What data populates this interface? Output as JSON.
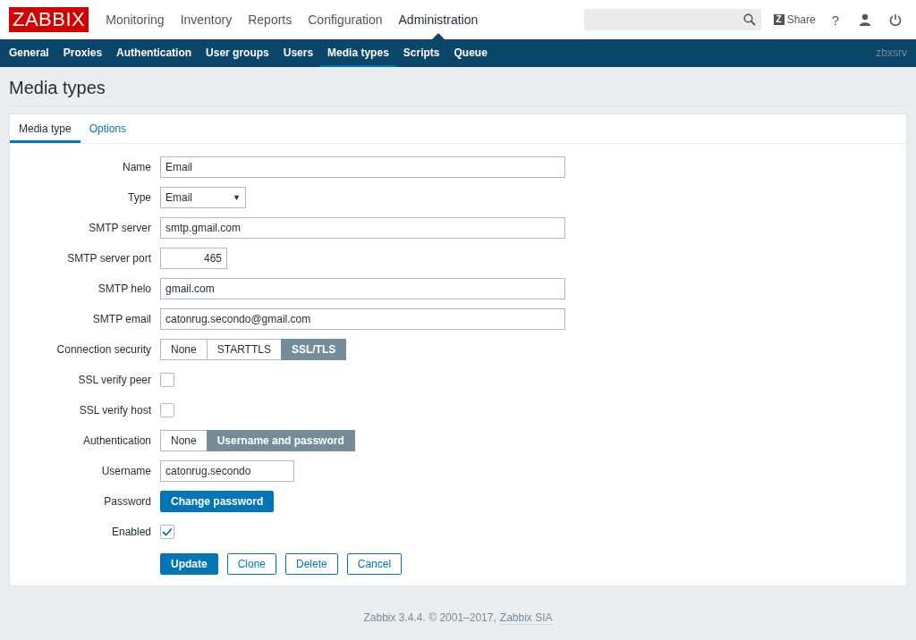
{
  "logo": "ZABBIX",
  "main_menu": [
    {
      "label": "Monitoring",
      "selected": false
    },
    {
      "label": "Inventory",
      "selected": false
    },
    {
      "label": "Reports",
      "selected": false
    },
    {
      "label": "Configuration",
      "selected": false
    },
    {
      "label": "Administration",
      "selected": true
    }
  ],
  "share": {
    "label": "Share",
    "icon_letter": "Z"
  },
  "help": "?",
  "sub_menu": [
    {
      "label": "General",
      "selected": false
    },
    {
      "label": "Proxies",
      "selected": false
    },
    {
      "label": "Authentication",
      "selected": false
    },
    {
      "label": "User groups",
      "selected": false
    },
    {
      "label": "Users",
      "selected": false
    },
    {
      "label": "Media types",
      "selected": true
    },
    {
      "label": "Scripts",
      "selected": false
    },
    {
      "label": "Queue",
      "selected": false
    }
  ],
  "server_name": "zbxsrv",
  "page_title": "Media types",
  "tabs": [
    {
      "label": "Media type",
      "selected": true
    },
    {
      "label": "Options",
      "selected": false
    }
  ],
  "form": [
    {
      "kind": "text",
      "label": "Name",
      "value": "Email"
    },
    {
      "kind": "select",
      "label": "Type",
      "value": "Email",
      "arrow": "▼"
    },
    {
      "kind": "text",
      "label": "SMTP server",
      "value": "smtp.gmail.com"
    },
    {
      "kind": "number",
      "label": "SMTP server port",
      "value": "465"
    },
    {
      "kind": "text",
      "label": "SMTP helo",
      "value": "gmail.com"
    },
    {
      "kind": "text",
      "label": "SMTP email",
      "value": "catonrug.secondo@gmail.com"
    },
    {
      "kind": "radio",
      "label": "Connection security",
      "options": [
        {
          "label": "None",
          "selected": false
        },
        {
          "label": "STARTTLS",
          "selected": false
        },
        {
          "label": "SSL/TLS",
          "selected": true
        }
      ]
    },
    {
      "kind": "checkbox",
      "label": "SSL verify peer",
      "checked": false
    },
    {
      "kind": "checkbox",
      "label": "SSL verify host",
      "checked": false
    },
    {
      "kind": "radio",
      "label": "Authentication",
      "options": [
        {
          "label": "None",
          "selected": false
        },
        {
          "label": "Username and password",
          "selected": true
        }
      ]
    },
    {
      "kind": "text-short",
      "label": "Username",
      "value": "catonrug.secondo"
    },
    {
      "kind": "button",
      "label": "Password",
      "button": "Change password"
    },
    {
      "kind": "checkbox",
      "label": "Enabled",
      "checked": true
    }
  ],
  "actions": [
    {
      "label": "Update",
      "primary": true
    },
    {
      "label": "Clone",
      "primary": false
    },
    {
      "label": "Delete",
      "primary": false
    },
    {
      "label": "Cancel",
      "primary": false
    }
  ],
  "footer": {
    "text": "Zabbix 3.4.4. © 2001–2017,",
    "link": "Zabbix SIA"
  }
}
